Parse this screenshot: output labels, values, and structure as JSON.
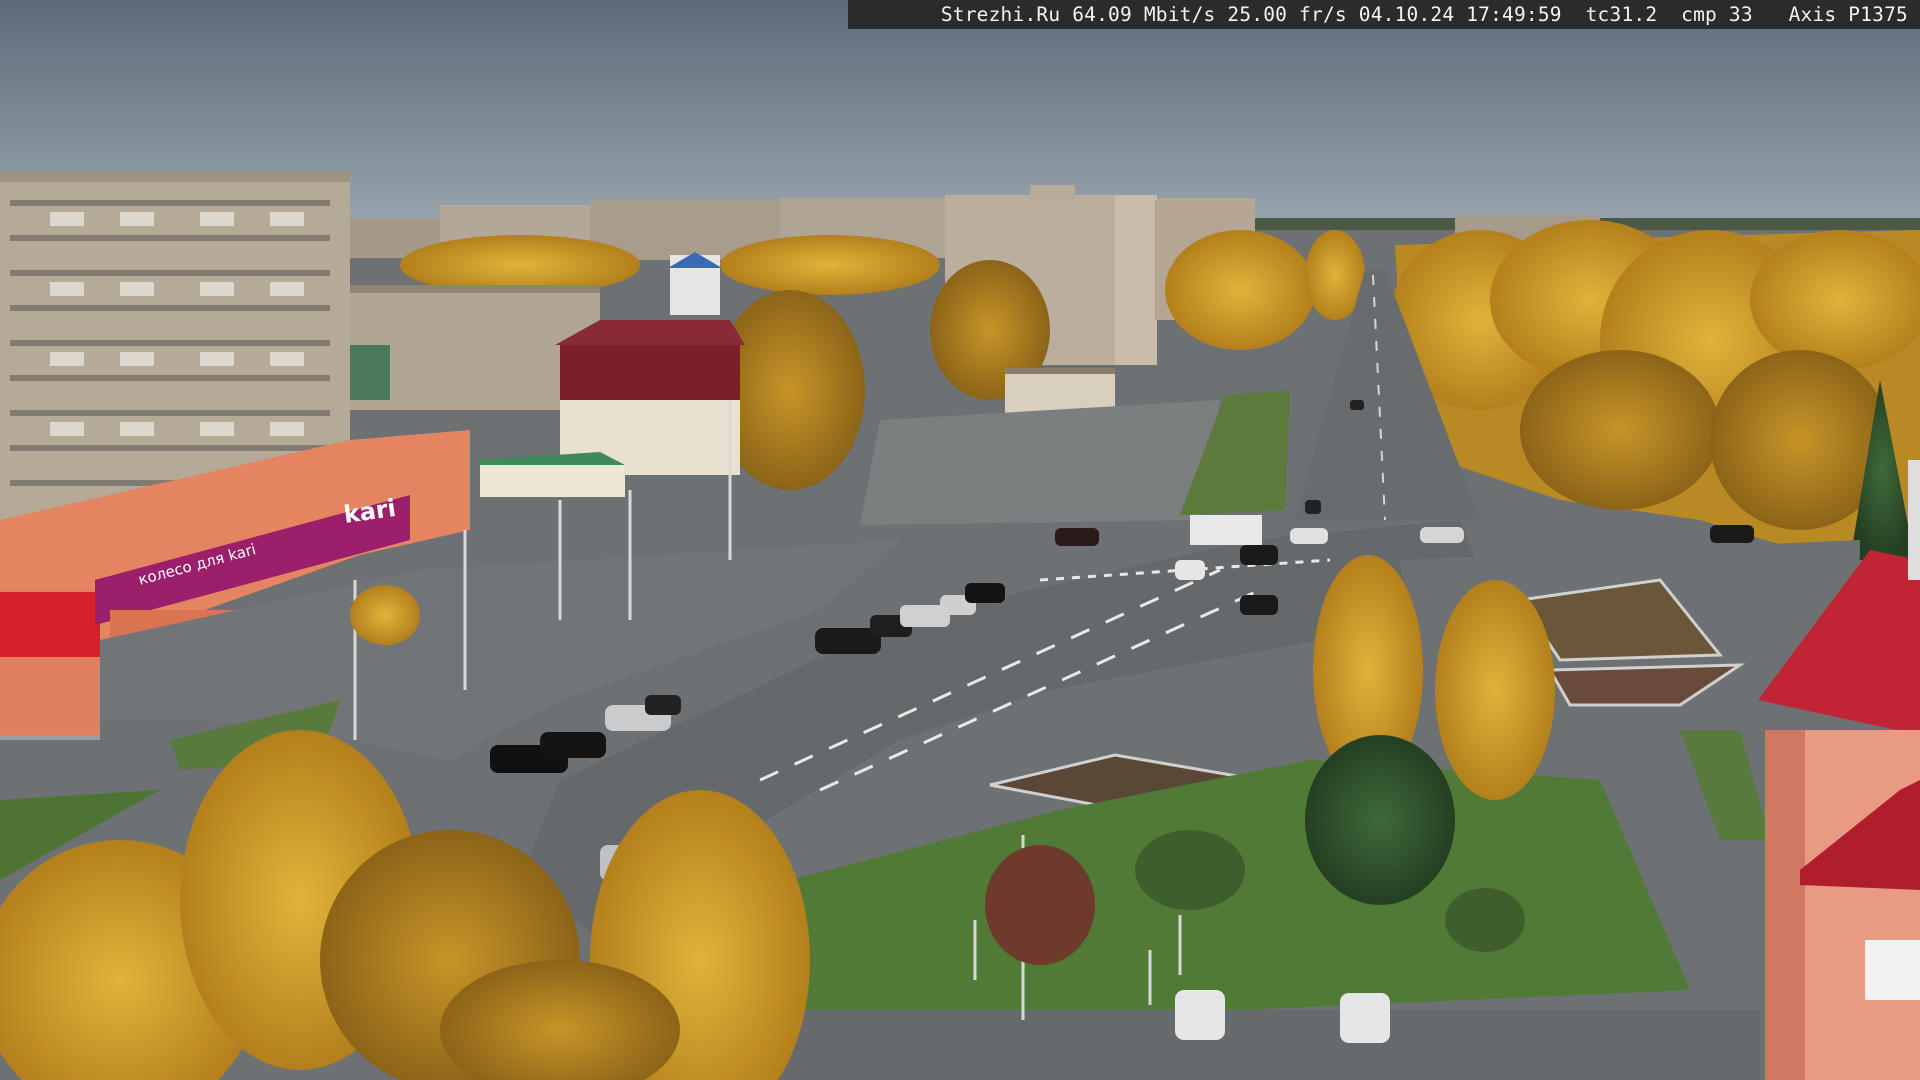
{
  "overlay": {
    "caption": "Strezhi.Ru 64.09 Mbit/s 25.00 fr/s 04.10.24 17:49:59  tc31.2  cmp 33   Axis P1375"
  },
  "signage": {
    "store_sign": "kari",
    "store_banner": "колесо для kari"
  },
  "colors": {
    "sky": "#7f8d9a",
    "asphalt": "#6a6e71",
    "foliage": "#d7a52b",
    "store_magenta": "#9b1f6a",
    "roof_red": "#c02535"
  }
}
